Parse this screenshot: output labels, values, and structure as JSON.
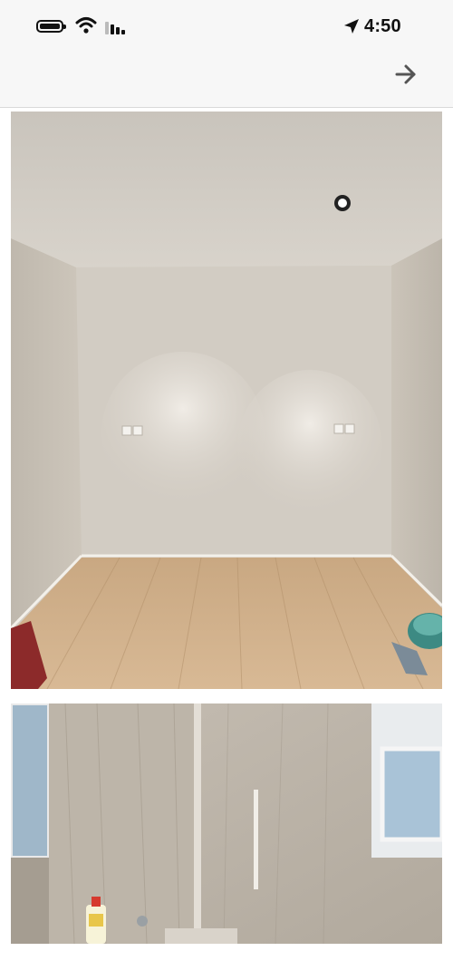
{
  "status_bar": {
    "time": "4:50",
    "icons": [
      "battery-icon",
      "wifi-icon",
      "signal-icon",
      "location-arrow-icon"
    ]
  },
  "nav_bar": {
    "icon": "arrow-right-icon"
  },
  "photos": [
    {
      "subject": "empty-room-wood-floor"
    },
    {
      "subject": "bathroom-stone-walls"
    }
  ]
}
